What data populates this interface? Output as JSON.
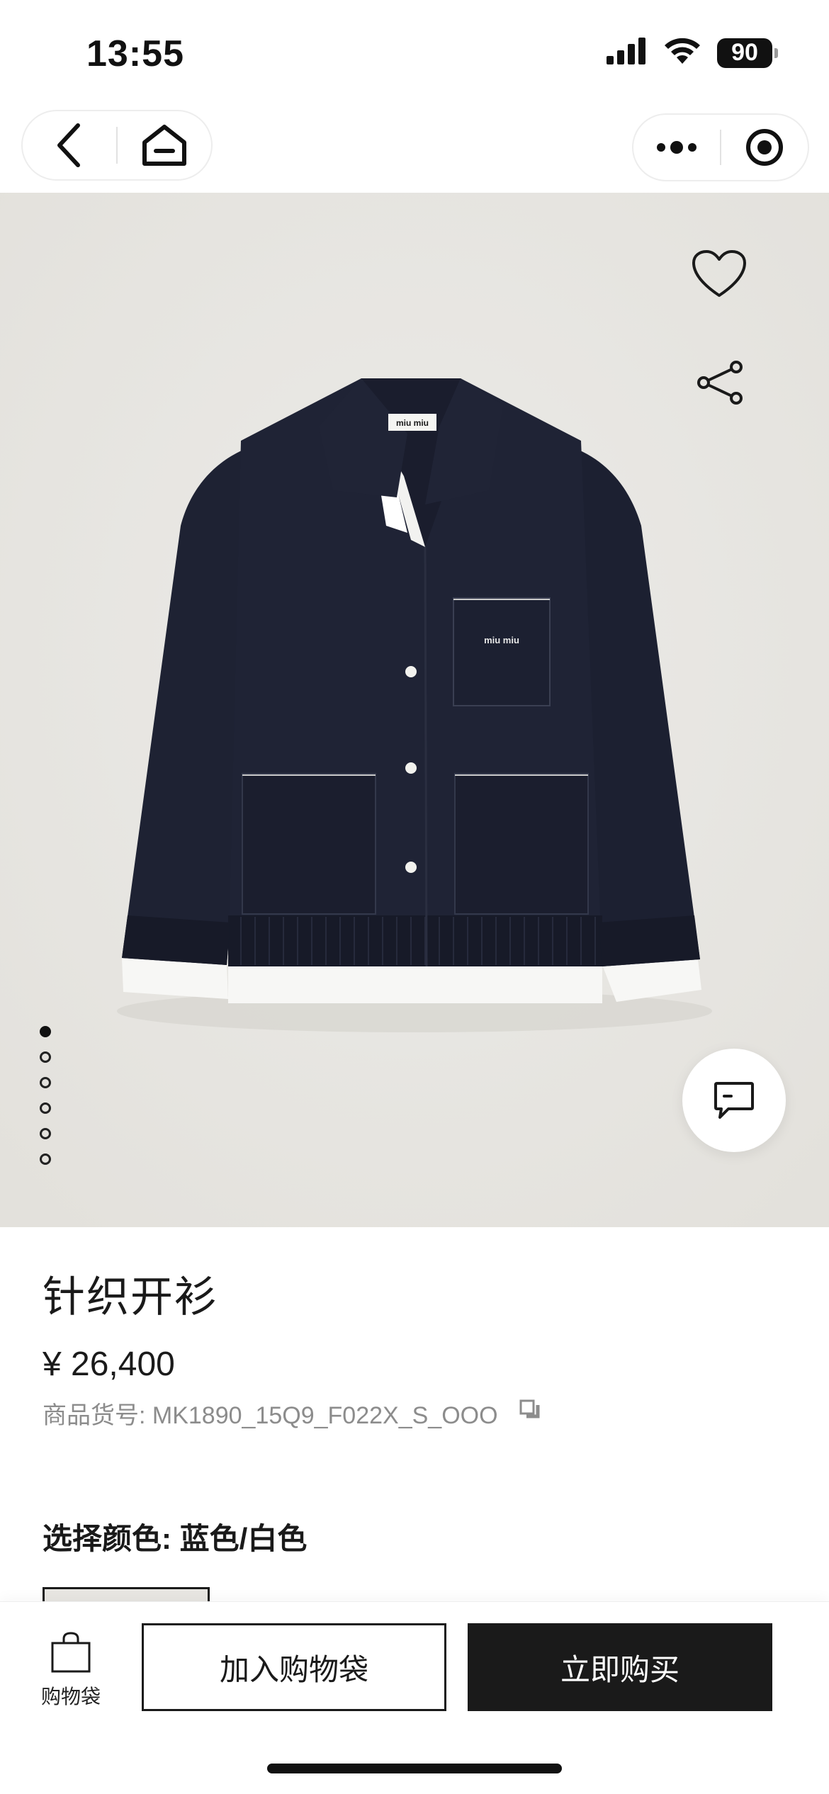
{
  "status_bar": {
    "time": "13:55",
    "battery": "90",
    "signal_icon": "cellular-signal-icon",
    "wifi_icon": "wifi-icon"
  },
  "nav": {
    "back_icon": "chevron-left-icon",
    "home_icon": "home-icon",
    "more_icon": "more-dots-icon",
    "close_icon": "target-circle-icon"
  },
  "hero": {
    "favorite_icon": "heart-icon",
    "share_icon": "share-icon",
    "chat_icon": "chat-bubble-icon",
    "collar_label": "miu miu",
    "pocket_label": "miu miu",
    "image_count": 6,
    "active_index": 0
  },
  "product": {
    "title": "针织开衫",
    "price": "¥ 26,400",
    "sku": "商品货号: MK1890_15Q9_F022X_S_OOO",
    "copy_icon": "copy-icon",
    "color_label": "选择颜色: 蓝色/白色"
  },
  "bottom_bar": {
    "bag_label": "购物袋",
    "bag_icon": "shopping-bag-icon",
    "add_to_bag": "加入购物袋",
    "buy_now": "立即购买"
  },
  "colors": {
    "jacket": "#1e2233",
    "background": "#e8e6e2",
    "primary": "#1a1a1a",
    "muted_text": "#8c8c8c"
  }
}
